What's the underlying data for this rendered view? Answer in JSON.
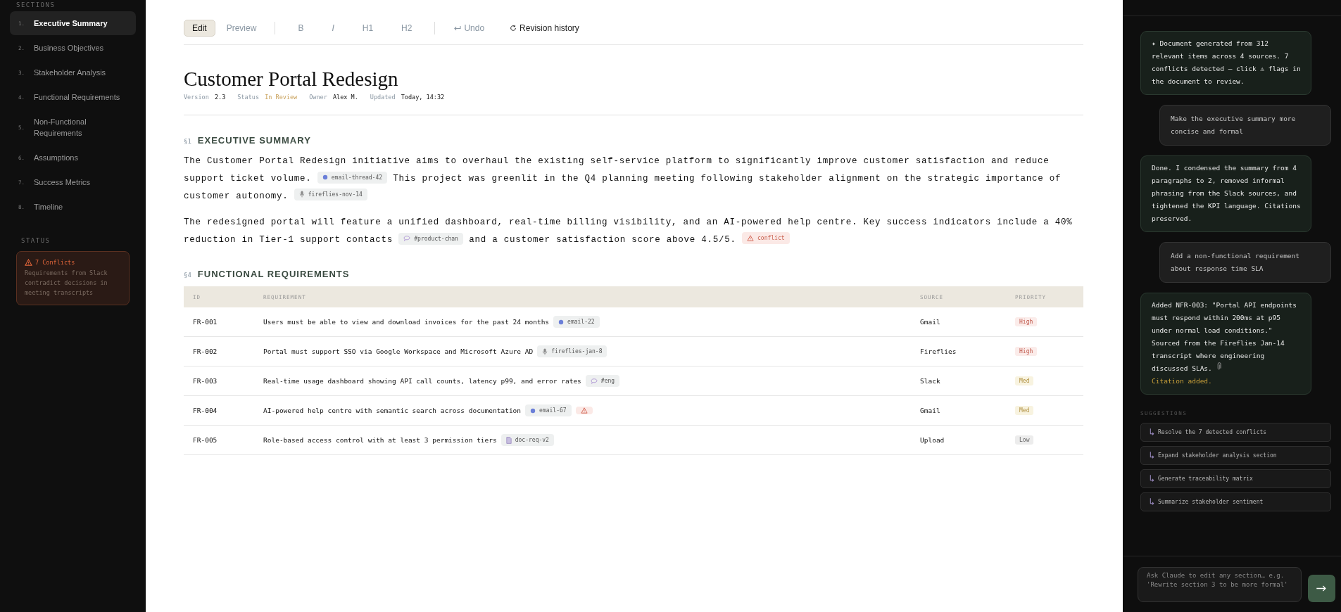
{
  "sidebar": {
    "heading": "SECTIONS",
    "items": [
      {
        "number": "1.",
        "label": "Executive Summary",
        "selected": true
      },
      {
        "number": "2.",
        "label": "Business Objectives",
        "selected": false
      },
      {
        "number": "3.",
        "label": "Stakeholder Analysis",
        "selected": false
      },
      {
        "number": "4.",
        "label": "Functional Requirements",
        "selected": false
      },
      {
        "number": "5.",
        "label": "Non-Functional Requirements",
        "selected": false
      },
      {
        "number": "6.",
        "label": "Assumptions",
        "selected": false
      },
      {
        "number": "7.",
        "label": "Success Metrics",
        "selected": false
      },
      {
        "number": "8.",
        "label": "Timeline",
        "selected": false
      }
    ],
    "status_heading": "STATUS",
    "status_card": {
      "title": "7 Conflicts",
      "text": "Requirements from Slack contradict decisions in meeting transcripts"
    }
  },
  "toolbar": {
    "mode_tabs": [
      {
        "label": "Edit",
        "selected": true
      },
      {
        "label": "Preview",
        "selected": false
      }
    ],
    "format_buttons": [
      {
        "kind": "bold",
        "label": "B"
      },
      {
        "kind": "italic",
        "label": "I"
      },
      {
        "kind": "plain",
        "label": "H1"
      },
      {
        "kind": "plain",
        "label": "H2"
      }
    ],
    "actions": [
      {
        "kind": "undo",
        "label": "Undo",
        "disabled": true
      },
      {
        "kind": "history",
        "label": "Revision history",
        "disabled": false
      }
    ]
  },
  "document": {
    "title": "Customer Portal Redesign",
    "meta": [
      {
        "label": "Version",
        "value": "2.3",
        "kind": "plain"
      },
      {
        "label": "Status",
        "value": "In Review",
        "kind": "status"
      },
      {
        "label": "Owner",
        "value": "Alex M.",
        "kind": "plain"
      },
      {
        "label": "Updated",
        "value": "Today, 14:32",
        "kind": "plain"
      }
    ],
    "sections": [
      {
        "number": "§1",
        "heading": "EXECUTIVE SUMMARY",
        "paragraphs": [
          [
            {
              "kind": "text",
              "text": "The Customer Portal Redesign initiative aims to overhaul the existing self-service platform to significantly improve customer satisfaction and reduce support ticket volume."
            },
            {
              "kind": "email",
              "label": "email-thread-42"
            },
            {
              "kind": "text",
              "text": "This project was greenlit in the Q4 planning meeting following stakeholder alignment on the strategic importance of customer autonomy."
            },
            {
              "kind": "fireflies",
              "label": "fireflies-nov-14"
            }
          ],
          [
            {
              "kind": "text",
              "text": "The redesigned portal will feature a unified dashboard, real-time billing visibility, and an AI-powered help centre. Key success indicators include a 40% reduction in Tier-1 support contacts"
            },
            {
              "kind": "slack",
              "label": "#product-chan"
            },
            {
              "kind": "text",
              "text": "and a customer satisfaction score above 4.5/5."
            },
            {
              "kind": "conflict",
              "label": "conflict"
            }
          ]
        ]
      },
      {
        "number": "§4",
        "heading": "FUNCTIONAL REQUIREMENTS",
        "table": {
          "columns": [
            "ID",
            "REQUIREMENT",
            "SOURCE",
            "PRIORITY"
          ],
          "rows": [
            {
              "id": "FR-001",
              "requirement": "Users must be able to view and download invoices for the past 24 months",
              "chips": [
                {
                  "kind": "email",
                  "label": "email-22"
                }
              ],
              "source": "Gmail",
              "priority": {
                "kind": "high",
                "label": "High"
              }
            },
            {
              "id": "FR-002",
              "requirement": "Portal must support SSO via Google Workspace and Microsoft Azure AD",
              "chips": [
                {
                  "kind": "fireflies",
                  "label": "fireflies-jan-8"
                }
              ],
              "source": "Fireflies",
              "priority": {
                "kind": "high",
                "label": "High"
              }
            },
            {
              "id": "FR-003",
              "requirement": "Real-time usage dashboard showing API call counts, latency p99, and error rates",
              "chips": [
                {
                  "kind": "slack",
                  "label": "#eng"
                }
              ],
              "source": "Slack",
              "priority": {
                "kind": "med",
                "label": "Med"
              }
            },
            {
              "id": "FR-004",
              "requirement": "AI-powered help centre with semantic search across documentation",
              "chips": [
                {
                  "kind": "email",
                  "label": "email-67"
                },
                {
                  "kind": "conflict"
                }
              ],
              "source": "Gmail",
              "priority": {
                "kind": "med",
                "label": "Med"
              }
            },
            {
              "id": "FR-005",
              "requirement": "Role-based access control with at least 3 permission tiers",
              "chips": [
                {
                  "kind": "upload",
                  "label": "doc-req-v2"
                }
              ],
              "source": "Upload",
              "priority": {
                "kind": "low",
                "label": "Low"
              }
            }
          ]
        }
      }
    ]
  },
  "chat": {
    "messages": [
      {
        "kind": "assistant",
        "text": "✦ Document generated from 312 relevant items across 4 sources. 7 conflicts detected — click ⚠ flags in the document to review."
      },
      {
        "kind": "user",
        "text": "Make the executive summary more concise and formal"
      },
      {
        "kind": "assistant",
        "text": "Done. I condensed the summary from 4 paragraphs to 2, removed informal phrasing from the Slack sources, and tightened the KPI language. Citations preserved."
      },
      {
        "kind": "user",
        "text": "Add a non-functional requirement about response time SLA"
      },
      {
        "kind": "assistant",
        "text": "Added NFR-003: \"Portal API endpoints must respond within 200ms at p95 under normal load conditions.\" Sourced from the Fireflies Jan-14 transcript where engineering discussed SLAs.",
        "citation_icon": true,
        "note": "Citation added."
      }
    ],
    "suggestions_heading": "SUGGESTIONS",
    "suggestions": [
      "Resolve the 7 detected conflicts",
      "Expand stakeholder analysis section",
      "Generate traceability matrix",
      "Summarize stakeholder sentiment"
    ],
    "input": {
      "placeholder": "Ask Claude to edit any section… e.g. 'Rewrite section 3 to be more formal'"
    }
  }
}
